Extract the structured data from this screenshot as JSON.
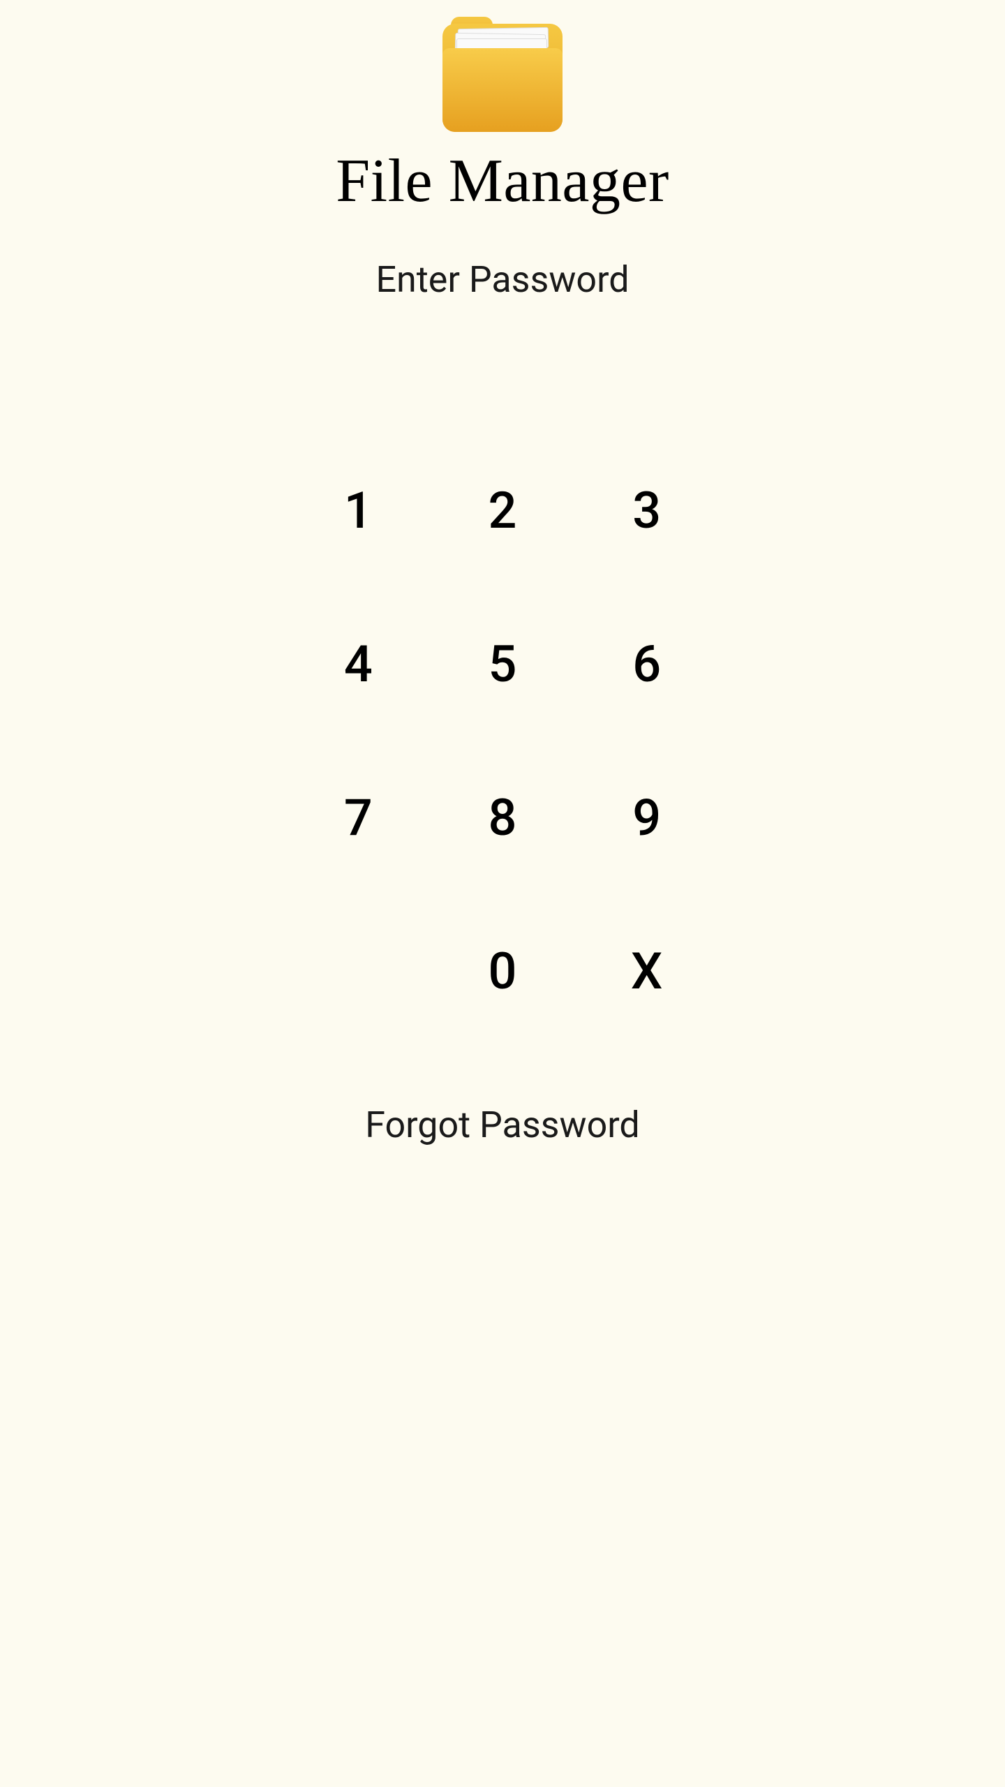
{
  "app": {
    "title": "File Manager"
  },
  "prompt": {
    "label": "Enter Password"
  },
  "keypad": {
    "keys": {
      "k1": "1",
      "k2": "2",
      "k3": "3",
      "k4": "4",
      "k5": "5",
      "k6": "6",
      "k7": "7",
      "k8": "8",
      "k9": "9",
      "k0": "0",
      "delete": "X"
    }
  },
  "footer": {
    "forgot_label": "Forgot Password"
  }
}
